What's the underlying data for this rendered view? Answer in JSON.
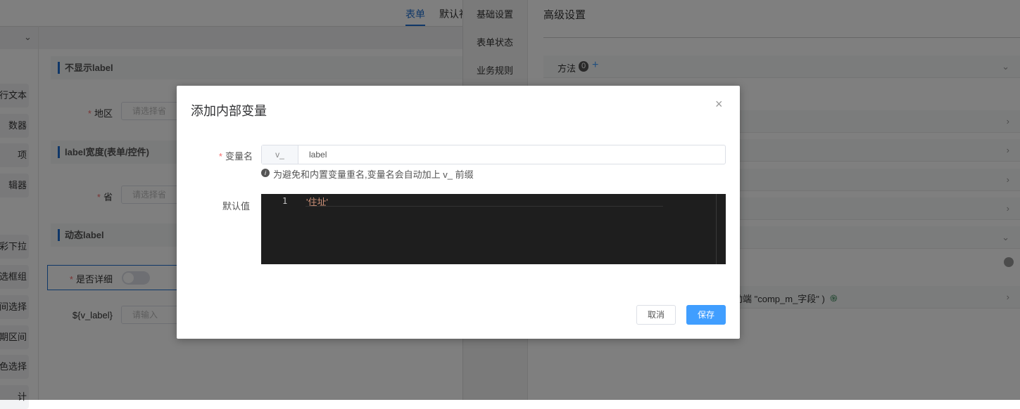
{
  "top_tabs": [
    {
      "label": "表单",
      "active": true
    },
    {
      "label": "默认社"
    }
  ],
  "sidebar": {
    "items": [
      "行文本",
      "数器",
      "项",
      "辑器",
      "彩下拉",
      "选框组",
      "间选择",
      "期区间",
      "色选择",
      "计"
    ]
  },
  "form": {
    "sections": [
      "不显示label",
      "label宽度(表单/控件)",
      "动态label"
    ],
    "fields": [
      {
        "label": "地区",
        "required": true,
        "placeholder": "请选择省"
      },
      {
        "label": "省",
        "required": true,
        "placeholder": "请选择省"
      },
      {
        "label": "是否详细",
        "required": true
      },
      {
        "label": "${v_label}",
        "required": false,
        "placeholder": "请输入"
      }
    ]
  },
  "right_nav": [
    "基础设置",
    "表单状态",
    "业务规则"
  ],
  "advanced": {
    "title": "高级设置",
    "methods_label": "方法",
    "methods_count": "0",
    "add_icon": "+",
    "event_row_text": "动端 \"comp_m_字段\" )"
  },
  "modal": {
    "title": "添加内部变量",
    "var_name_label": "变量名",
    "prefix": "v_",
    "var_name_value": "label",
    "hint": "为避免和内置变量重名,变量名会自动加上 v_ 前缀",
    "default_label": "默认值",
    "code_line_number": "1",
    "code": "'住址'",
    "cancel": "取消",
    "save": "保存"
  },
  "colors": {
    "primary": "#409eff",
    "accent_blue": "#1f6fd1",
    "code_bg": "#1e1e1e",
    "code_string": "#ce9178",
    "required": "#f56c6c"
  }
}
